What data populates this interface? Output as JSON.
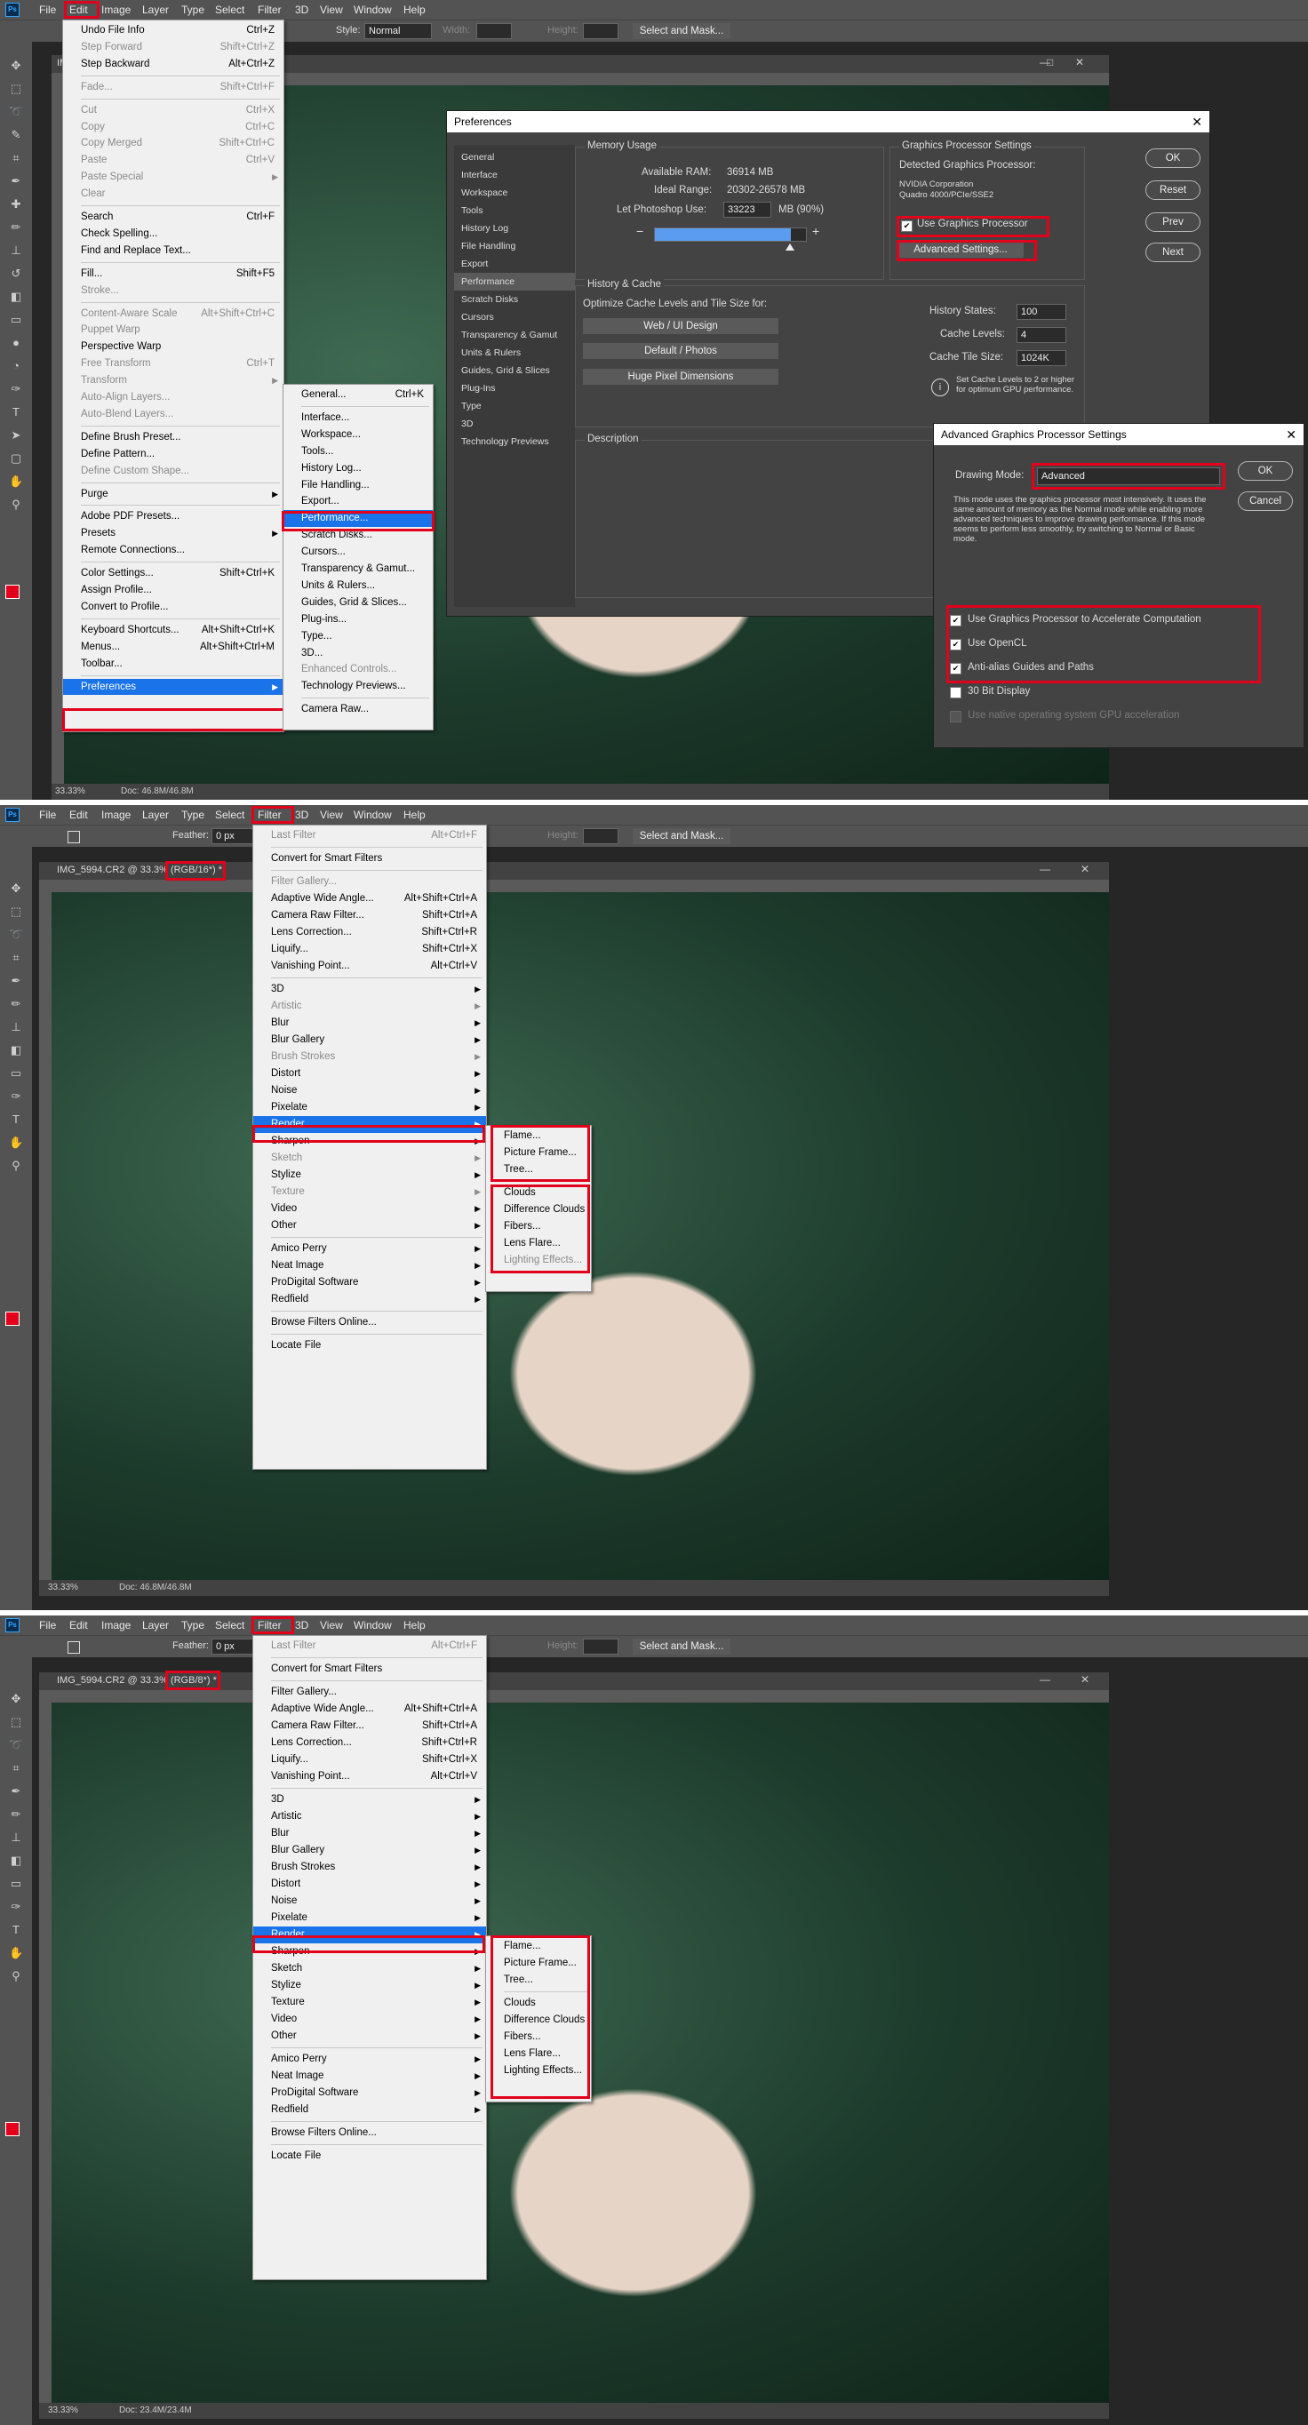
{
  "panels": [
    {
      "menubar": [
        "File",
        "Edit",
        "Image",
        "Layer",
        "Type",
        "Select",
        "Filter",
        "3D",
        "View",
        "Window",
        "Help"
      ],
      "options": {
        "style_label": "Style:",
        "style_value": "Normal",
        "width_label": "Width:",
        "height_label": "Height:",
        "select_mask": "Select and Mask..."
      },
      "doc_tab": "IM",
      "status": {
        "zoom": "33.33%",
        "doc": "Doc: 46.8M/46.8M"
      },
      "edit_menu": [
        {
          "label": "Undo File Info",
          "sc": "Ctrl+Z",
          "dis": false
        },
        {
          "label": "Step Forward",
          "sc": "Shift+Ctrl+Z",
          "dis": true
        },
        {
          "label": "Step Backward",
          "sc": "Alt+Ctrl+Z",
          "dis": false
        },
        {
          "sep": true
        },
        {
          "label": "Fade...",
          "sc": "Shift+Ctrl+F",
          "dis": true
        },
        {
          "sep": true
        },
        {
          "label": "Cut",
          "sc": "Ctrl+X",
          "dis": true
        },
        {
          "label": "Copy",
          "sc": "Ctrl+C",
          "dis": true
        },
        {
          "label": "Copy Merged",
          "sc": "Shift+Ctrl+C",
          "dis": true
        },
        {
          "label": "Paste",
          "sc": "Ctrl+V",
          "dis": true
        },
        {
          "label": "Paste Special",
          "sc": "",
          "dis": true,
          "sub": true
        },
        {
          "label": "Clear",
          "sc": "",
          "dis": true
        },
        {
          "sep": true
        },
        {
          "label": "Search",
          "sc": "Ctrl+F",
          "dis": false
        },
        {
          "label": "Check Spelling...",
          "sc": "",
          "dis": false
        },
        {
          "label": "Find and Replace Text...",
          "sc": "",
          "dis": false
        },
        {
          "sep": true
        },
        {
          "label": "Fill...",
          "sc": "Shift+F5",
          "dis": false
        },
        {
          "label": "Stroke...",
          "sc": "",
          "dis": true
        },
        {
          "sep": true
        },
        {
          "label": "Content-Aware Scale",
          "sc": "Alt+Shift+Ctrl+C",
          "dis": true
        },
        {
          "label": "Puppet Warp",
          "sc": "",
          "dis": true
        },
        {
          "label": "Perspective Warp",
          "sc": "",
          "dis": false
        },
        {
          "label": "Free Transform",
          "sc": "Ctrl+T",
          "dis": true
        },
        {
          "label": "Transform",
          "sc": "",
          "dis": true,
          "sub": true
        },
        {
          "label": "Auto-Align Layers...",
          "sc": "",
          "dis": true
        },
        {
          "label": "Auto-Blend Layers...",
          "sc": "",
          "dis": true
        },
        {
          "sep": true
        },
        {
          "label": "Define Brush Preset...",
          "sc": "",
          "dis": false
        },
        {
          "label": "Define Pattern...",
          "sc": "",
          "dis": false
        },
        {
          "label": "Define Custom Shape...",
          "sc": "",
          "dis": true
        },
        {
          "sep": true
        },
        {
          "label": "Purge",
          "sc": "",
          "dis": false,
          "sub": true
        },
        {
          "sep": true
        },
        {
          "label": "Adobe PDF Presets...",
          "sc": "",
          "dis": false
        },
        {
          "label": "Presets",
          "sc": "",
          "dis": false,
          "sub": true
        },
        {
          "label": "Remote Connections...",
          "sc": "",
          "dis": false
        },
        {
          "sep": true
        },
        {
          "label": "Color Settings...",
          "sc": "Shift+Ctrl+K",
          "dis": false
        },
        {
          "label": "Assign Profile...",
          "sc": "",
          "dis": false
        },
        {
          "label": "Convert to Profile...",
          "sc": "",
          "dis": false
        },
        {
          "sep": true
        },
        {
          "label": "Keyboard Shortcuts...",
          "sc": "Alt+Shift+Ctrl+K",
          "dis": false
        },
        {
          "label": "Menus...",
          "sc": "Alt+Shift+Ctrl+M",
          "dis": false
        },
        {
          "label": "Toolbar...",
          "sc": "",
          "dis": false
        },
        {
          "sep": true
        },
        {
          "label": "Preferences",
          "sc": "",
          "dis": false,
          "sub": true,
          "hl": true
        }
      ],
      "prefs_menu": [
        {
          "label": "General...",
          "sc": "Ctrl+K",
          "dis": false
        },
        {
          "sep": true
        },
        {
          "label": "Interface...",
          "sc": "",
          "dis": false
        },
        {
          "label": "Workspace...",
          "sc": "",
          "dis": false
        },
        {
          "label": "Tools...",
          "sc": "",
          "dis": false
        },
        {
          "label": "History Log...",
          "sc": "",
          "dis": false
        },
        {
          "label": "File Handling...",
          "sc": "",
          "dis": false
        },
        {
          "label": "Export...",
          "sc": "",
          "dis": false
        },
        {
          "label": "Performance...",
          "sc": "",
          "dis": false,
          "hl": true
        },
        {
          "label": "Scratch Disks...",
          "sc": "",
          "dis": false
        },
        {
          "label": "Cursors...",
          "sc": "",
          "dis": false
        },
        {
          "label": "Transparency & Gamut...",
          "sc": "",
          "dis": false
        },
        {
          "label": "Units & Rulers...",
          "sc": "",
          "dis": false
        },
        {
          "label": "Guides, Grid & Slices...",
          "sc": "",
          "dis": false
        },
        {
          "label": "Plug-ins...",
          "sc": "",
          "dis": false
        },
        {
          "label": "Type...",
          "sc": "",
          "dis": false
        },
        {
          "label": "3D...",
          "sc": "",
          "dis": false
        },
        {
          "label": "Enhanced Controls...",
          "sc": "",
          "dis": true
        },
        {
          "label": "Technology Previews...",
          "sc": "",
          "dis": false
        },
        {
          "sep": true
        },
        {
          "label": "Camera Raw...",
          "sc": "",
          "dis": false
        }
      ]
    },
    {
      "menubar": [
        "File",
        "Edit",
        "Image",
        "Layer",
        "Type",
        "Select",
        "Filter",
        "3D",
        "View",
        "Window",
        "Help"
      ],
      "options": {
        "feather_label": "Feather:",
        "feather_value": "0 px",
        "height_label": "Height:",
        "select_mask": "Select and Mask..."
      },
      "doc_tab": "IMG_5994.CR2 @ 33.3% (RGB/16*) *",
      "status": {
        "zoom": "33.33%",
        "doc": "Doc: 46.8M/46.8M"
      }
    },
    {
      "menubar": [
        "File",
        "Edit",
        "Image",
        "Layer",
        "Type",
        "Select",
        "Filter",
        "3D",
        "View",
        "Window",
        "Help"
      ],
      "options": {
        "feather_label": "Feather:",
        "feather_value": "0 px",
        "height_label": "Height:",
        "select_mask": "Select and Mask..."
      },
      "doc_tab": "IMG_5994.CR2 @ 33.3% (RGB/8*) *",
      "status": {
        "zoom": "33.33%",
        "doc": "Doc: 23.4M/23.4M"
      }
    }
  ],
  "filter_menus": [
    [
      {
        "label": "Last Filter",
        "sc": "Alt+Ctrl+F",
        "dis": true
      },
      {
        "sep": true
      },
      {
        "label": "Convert for Smart Filters",
        "sc": "",
        "dis": false
      },
      {
        "sep": true
      },
      {
        "label": "Filter Gallery...",
        "sc": "",
        "dis": true
      },
      {
        "label": "Adaptive Wide Angle...",
        "sc": "Alt+Shift+Ctrl+A",
        "dis": false
      },
      {
        "label": "Camera Raw Filter...",
        "sc": "Shift+Ctrl+A",
        "dis": false
      },
      {
        "label": "Lens Correction...",
        "sc": "Shift+Ctrl+R",
        "dis": false
      },
      {
        "label": "Liquify...",
        "sc": "Shift+Ctrl+X",
        "dis": false
      },
      {
        "label": "Vanishing Point...",
        "sc": "Alt+Ctrl+V",
        "dis": false
      },
      {
        "sep": true
      },
      {
        "label": "3D",
        "sc": "",
        "dis": false,
        "sub": true
      },
      {
        "label": "Artistic",
        "sc": "",
        "dis": true,
        "sub": true
      },
      {
        "label": "Blur",
        "sc": "",
        "dis": false,
        "sub": true
      },
      {
        "label": "Blur Gallery",
        "sc": "",
        "dis": false,
        "sub": true
      },
      {
        "label": "Brush Strokes",
        "sc": "",
        "dis": true,
        "sub": true
      },
      {
        "label": "Distort",
        "sc": "",
        "dis": false,
        "sub": true
      },
      {
        "label": "Noise",
        "sc": "",
        "dis": false,
        "sub": true
      },
      {
        "label": "Pixelate",
        "sc": "",
        "dis": false,
        "sub": true
      },
      {
        "label": "Render",
        "sc": "",
        "dis": false,
        "sub": true,
        "hl": true
      },
      {
        "label": "Sharpen",
        "sc": "",
        "dis": false,
        "sub": true
      },
      {
        "label": "Sketch",
        "sc": "",
        "dis": true,
        "sub": true
      },
      {
        "label": "Stylize",
        "sc": "",
        "dis": false,
        "sub": true
      },
      {
        "label": "Texture",
        "sc": "",
        "dis": true,
        "sub": true
      },
      {
        "label": "Video",
        "sc": "",
        "dis": false,
        "sub": true
      },
      {
        "label": "Other",
        "sc": "",
        "dis": false,
        "sub": true
      },
      {
        "sep": true
      },
      {
        "label": "Amico Perry",
        "sc": "",
        "dis": false,
        "sub": true
      },
      {
        "label": "Neat Image",
        "sc": "",
        "dis": false,
        "sub": true
      },
      {
        "label": "ProDigital Software",
        "sc": "",
        "dis": false,
        "sub": true
      },
      {
        "label": "Redfield",
        "sc": "",
        "dis": false,
        "sub": true
      },
      {
        "sep": true
      },
      {
        "label": "Browse Filters Online...",
        "sc": "",
        "dis": false
      },
      {
        "sep": true
      },
      {
        "label": "Locate File",
        "sc": "",
        "dis": false
      }
    ],
    [
      {
        "label": "Last Filter",
        "sc": "Alt+Ctrl+F",
        "dis": true
      },
      {
        "sep": true
      },
      {
        "label": "Convert for Smart Filters",
        "sc": "",
        "dis": false
      },
      {
        "sep": true
      },
      {
        "label": "Filter Gallery...",
        "sc": "",
        "dis": false
      },
      {
        "label": "Adaptive Wide Angle...",
        "sc": "Alt+Shift+Ctrl+A",
        "dis": false
      },
      {
        "label": "Camera Raw Filter...",
        "sc": "Shift+Ctrl+A",
        "dis": false
      },
      {
        "label": "Lens Correction...",
        "sc": "Shift+Ctrl+R",
        "dis": false
      },
      {
        "label": "Liquify...",
        "sc": "Shift+Ctrl+X",
        "dis": false
      },
      {
        "label": "Vanishing Point...",
        "sc": "Alt+Ctrl+V",
        "dis": false
      },
      {
        "sep": true
      },
      {
        "label": "3D",
        "sc": "",
        "dis": false,
        "sub": true
      },
      {
        "label": "Artistic",
        "sc": "",
        "dis": false,
        "sub": true
      },
      {
        "label": "Blur",
        "sc": "",
        "dis": false,
        "sub": true
      },
      {
        "label": "Blur Gallery",
        "sc": "",
        "dis": false,
        "sub": true
      },
      {
        "label": "Brush Strokes",
        "sc": "",
        "dis": false,
        "sub": true
      },
      {
        "label": "Distort",
        "sc": "",
        "dis": false,
        "sub": true
      },
      {
        "label": "Noise",
        "sc": "",
        "dis": false,
        "sub": true
      },
      {
        "label": "Pixelate",
        "sc": "",
        "dis": false,
        "sub": true
      },
      {
        "label": "Render",
        "sc": "",
        "dis": false,
        "sub": true,
        "hl": true
      },
      {
        "label": "Sharpen",
        "sc": "",
        "dis": false,
        "sub": true
      },
      {
        "label": "Sketch",
        "sc": "",
        "dis": false,
        "sub": true
      },
      {
        "label": "Stylize",
        "sc": "",
        "dis": false,
        "sub": true
      },
      {
        "label": "Texture",
        "sc": "",
        "dis": false,
        "sub": true
      },
      {
        "label": "Video",
        "sc": "",
        "dis": false,
        "sub": true
      },
      {
        "label": "Other",
        "sc": "",
        "dis": false,
        "sub": true
      },
      {
        "sep": true
      },
      {
        "label": "Amico Perry",
        "sc": "",
        "dis": false,
        "sub": true
      },
      {
        "label": "Neat Image",
        "sc": "",
        "dis": false,
        "sub": true
      },
      {
        "label": "ProDigital Software",
        "sc": "",
        "dis": false,
        "sub": true
      },
      {
        "label": "Redfield",
        "sc": "",
        "dis": false,
        "sub": true
      },
      {
        "sep": true
      },
      {
        "label": "Browse Filters Online...",
        "sc": "",
        "dis": false
      },
      {
        "sep": true
      },
      {
        "label": "Locate File",
        "sc": "",
        "dis": false
      }
    ]
  ],
  "render_menus": [
    [
      {
        "label": "Flame...",
        "dis": false
      },
      {
        "label": "Picture Frame...",
        "dis": false
      },
      {
        "label": "Tree...",
        "dis": false
      },
      {
        "sep": true
      },
      {
        "label": "Clouds",
        "dis": false
      },
      {
        "label": "Difference Clouds",
        "dis": false
      },
      {
        "label": "Fibers...",
        "dis": false
      },
      {
        "label": "Lens Flare...",
        "dis": false
      },
      {
        "label": "Lighting Effects...",
        "dis": true
      }
    ],
    [
      {
        "label": "Flame...",
        "dis": false
      },
      {
        "label": "Picture Frame...",
        "dis": false
      },
      {
        "label": "Tree...",
        "dis": false
      },
      {
        "sep": true
      },
      {
        "label": "Clouds",
        "dis": false
      },
      {
        "label": "Difference Clouds",
        "dis": false
      },
      {
        "label": "Fibers...",
        "dis": false
      },
      {
        "label": "Lens Flare...",
        "dis": false
      },
      {
        "label": "Lighting Effects...",
        "dis": false
      }
    ]
  ],
  "preferences": {
    "title": "Preferences",
    "sidebar": [
      "General",
      "Interface",
      "Workspace",
      "Tools",
      "History Log",
      "File Handling",
      "Export",
      "Performance",
      "Scratch Disks",
      "Cursors",
      "Transparency & Gamut",
      "Units & Rulers",
      "Guides, Grid & Slices",
      "Plug-Ins",
      "Type",
      "3D",
      "Technology Previews"
    ],
    "selected_sidebar": "Performance",
    "memory": {
      "title": "Memory Usage",
      "available_label": "Available RAM:",
      "available_value": "36914 MB",
      "ideal_label": "Ideal Range:",
      "ideal_value": "20302-26578 MB",
      "let_label": "Let Photoshop Use:",
      "let_value": "33223",
      "let_unit": "MB (90%)",
      "slider_fraction": 0.9,
      "minus": "−",
      "plus": "+"
    },
    "gpu": {
      "title": "Graphics Processor Settings",
      "detected_label": "Detected Graphics Processor:",
      "vendor": "NVIDIA Corporation",
      "model": "Quadro 4000/PCIe/SSE2",
      "use_gpu_label": "Use Graphics Processor",
      "advanced_btn": "Advanced Settings..."
    },
    "history": {
      "title": "History & Cache",
      "optimize_label": "Optimize Cache Levels and Tile Size for:",
      "btn1": "Web / UI Design",
      "btn2": "Default / Photos",
      "btn3": "Huge Pixel Dimensions",
      "states_label": "History States:",
      "states_value": "100",
      "levels_label": "Cache Levels:",
      "levels_value": "4",
      "tile_label": "Cache Tile Size:",
      "tile_value": "1024K",
      "info": "Set Cache Levels to 2 or higher for optimum GPU performance."
    },
    "description_title": "Description",
    "buttons": {
      "ok": "OK",
      "reset": "Reset",
      "prev": "Prev",
      "next": "Next"
    }
  },
  "advanced_gpu": {
    "title": "Advanced Graphics Processor Settings",
    "mode_label": "Drawing Mode:",
    "mode_value": "Advanced",
    "mode_desc": "This mode uses the graphics processor most intensively.  It uses the same amount of memory as the Normal mode while enabling more advanced techniques to improve drawing performance.  If this mode seems to perform less smoothly, try switching to Normal or Basic mode.",
    "options": [
      {
        "label": "Use Graphics Processor to Accelerate Computation",
        "checked": true,
        "dis": false
      },
      {
        "label": "Use OpenCL",
        "checked": true,
        "dis": false
      },
      {
        "label": "Anti-alias Guides and Paths",
        "checked": true,
        "dis": false
      },
      {
        "label": "30 Bit Display",
        "checked": false,
        "dis": false
      },
      {
        "label": "Use native operating system GPU acceleration",
        "checked": false,
        "dis": true
      }
    ],
    "ok": "OK",
    "cancel": "Cancel"
  },
  "icons": {
    "ps": "ps-logo-icon",
    "submenu": "submenu-arrow-icon",
    "close": "close-icon",
    "minimize": "minimize-icon",
    "maximize": "maximize-icon",
    "info": "info-icon",
    "checkbox": "checkbox-icon"
  },
  "colors": {
    "highlight": "#1a73e8",
    "annotation": "#e3001b",
    "menubar": "#535353",
    "foreground_swatch": "#e3001b",
    "background_swatch": "#ffffff"
  }
}
